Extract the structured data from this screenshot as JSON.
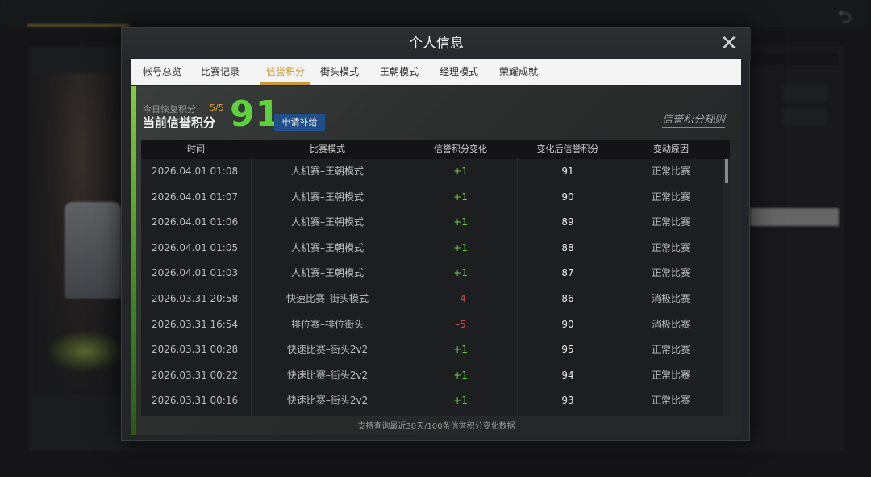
{
  "modal": {
    "title": "个人信息",
    "close_symbol": "✕"
  },
  "tabs": [
    {
      "label": "帐号总览",
      "active": false
    },
    {
      "label": "比赛记录",
      "active": false
    },
    {
      "label": "信誉积分",
      "active": true
    },
    {
      "label": "街头模式",
      "active": false
    },
    {
      "label": "王朝模式",
      "active": false
    },
    {
      "label": "经理模式",
      "active": false
    },
    {
      "label": "荣耀成就",
      "active": false
    }
  ],
  "credit": {
    "recover_label": "今日恢复积分",
    "recover_count": "5/5",
    "current_label": "当前信誉积分",
    "score": "91",
    "apply_label": "申请补给",
    "rules_label": "信誉积分规则"
  },
  "table": {
    "headers": [
      "时间",
      "比赛模式",
      "信誉积分变化",
      "变化后信誉积分",
      "变动原因"
    ],
    "rows": [
      {
        "time": "2026.04.01   01:08",
        "mode": "人机赛–王朝模式",
        "change": "+1",
        "after": "91",
        "reason": "正常比赛"
      },
      {
        "time": "2026.04.01   01:07",
        "mode": "人机赛–王朝模式",
        "change": "+1",
        "after": "90",
        "reason": "正常比赛"
      },
      {
        "time": "2026.04.01   01:06",
        "mode": "人机赛–王朝模式",
        "change": "+1",
        "after": "89",
        "reason": "正常比赛"
      },
      {
        "time": "2026.04.01   01:05",
        "mode": "人机赛–王朝模式",
        "change": "+1",
        "after": "88",
        "reason": "正常比赛"
      },
      {
        "time": "2026.04.01   01:03",
        "mode": "人机赛–王朝模式",
        "change": "+1",
        "after": "87",
        "reason": "正常比赛"
      },
      {
        "time": "2026.03.31   20:58",
        "mode": "快速比赛–街头模式",
        "change": "–4",
        "after": "86",
        "reason": "消极比赛"
      },
      {
        "time": "2026.03.31   16:54",
        "mode": "排位赛–排位街头",
        "change": "–5",
        "after": "90",
        "reason": "消极比赛"
      },
      {
        "time": "2026.03.31   00:28",
        "mode": "快速比赛–街头2v2",
        "change": "+1",
        "after": "95",
        "reason": "正常比赛"
      },
      {
        "time": "2026.03.31   00:22",
        "mode": "快速比赛–街头2v2",
        "change": "+1",
        "after": "94",
        "reason": "正常比赛"
      },
      {
        "time": "2026.03.31   00:16",
        "mode": "快速比赛–街头2v2",
        "change": "+1",
        "after": "93",
        "reason": "正常比赛"
      }
    ],
    "footer": "支持查询最近30天/100条信誉积分变化数据"
  },
  "colors": {
    "accent_gold": "#c79a33",
    "score_green": "#5fd13c",
    "positive": "#63d13f",
    "negative": "#e04141",
    "apply_blue": "#1e4f8a"
  },
  "icons": {
    "close": "close-icon",
    "back": "back-arrow-icon"
  }
}
